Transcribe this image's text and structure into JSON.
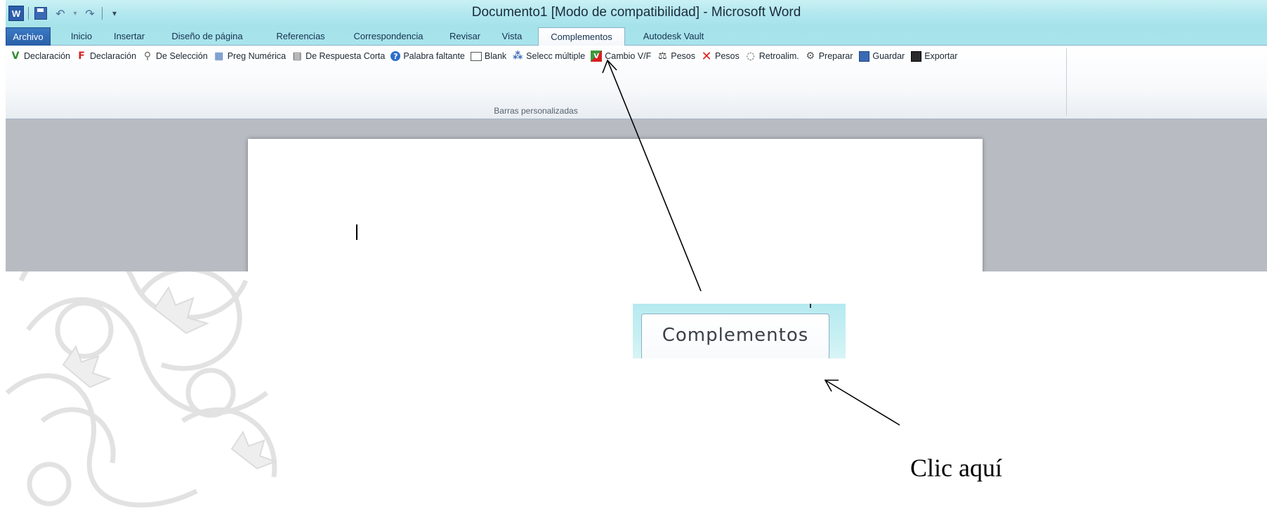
{
  "window": {
    "title": "Documento1 [Modo de compatibilidad] - Microsoft Word",
    "quick_access": [
      "word-logo-icon",
      "save-icon",
      "undo-icon",
      "redo-icon",
      "customize-quick-access-icon"
    ],
    "word_logo_letter": "W"
  },
  "tabs": [
    {
      "label": "Archivo",
      "active": false
    },
    {
      "label": "Inicio",
      "active": false
    },
    {
      "label": "Insertar",
      "active": false
    },
    {
      "label": "Diseño de página",
      "active": false
    },
    {
      "label": "Referencias",
      "active": false
    },
    {
      "label": "Correspondencia",
      "active": false
    },
    {
      "label": "Revisar",
      "active": false
    },
    {
      "label": "Vista",
      "active": false
    },
    {
      "label": "Complementos",
      "active": true
    },
    {
      "label": "Autodesk Vault",
      "active": false
    }
  ],
  "ribbon": {
    "group_label": "Barras personalizadas",
    "buttons": [
      {
        "label": "Declaración",
        "icon": "v-letter-icon",
        "color": "#2e8b2e"
      },
      {
        "label": "Declaración",
        "icon": "f-letter-icon",
        "color": "#d42020"
      },
      {
        "label": "De Selección",
        "icon": "pin-icon",
        "color": "#666666"
      },
      {
        "label": "Preg Numérica",
        "icon": "calculator-icon",
        "color": "#3a6ab5"
      },
      {
        "label": "De Respuesta Corta",
        "icon": "table-icon",
        "color": "#444444"
      },
      {
        "label": "Palabra faltante",
        "icon": "help-icon",
        "color": "#2a6fc9"
      },
      {
        "label": "Blank",
        "icon": "blank-box-icon",
        "color": "#555555"
      },
      {
        "label": "Selecc múltiple",
        "icon": "hierarchy-icon",
        "color": "#3a6ab5"
      },
      {
        "label": "Cambio V/F",
        "icon": "vf-icon",
        "color": "#2e8b2e"
      },
      {
        "label": "Pesos",
        "icon": "scales-icon",
        "color": "#333333"
      },
      {
        "label": "Pesos",
        "icon": "red-x-icon",
        "color": "#e02020"
      },
      {
        "label": "Retroalim.",
        "icon": "speech-bubble-icon",
        "color": "#444444"
      },
      {
        "label": "Preparar",
        "icon": "gears-icon",
        "color": "#555555"
      },
      {
        "label": "Guardar",
        "icon": "save-icon",
        "color": "#3a6ab5"
      },
      {
        "label": "Exportar",
        "icon": "export-disk-icon",
        "color": "#2a2a2a"
      }
    ]
  },
  "zoom_inset": {
    "tab_label": "Complementos"
  },
  "annotation": {
    "text": "Clic aquí"
  }
}
